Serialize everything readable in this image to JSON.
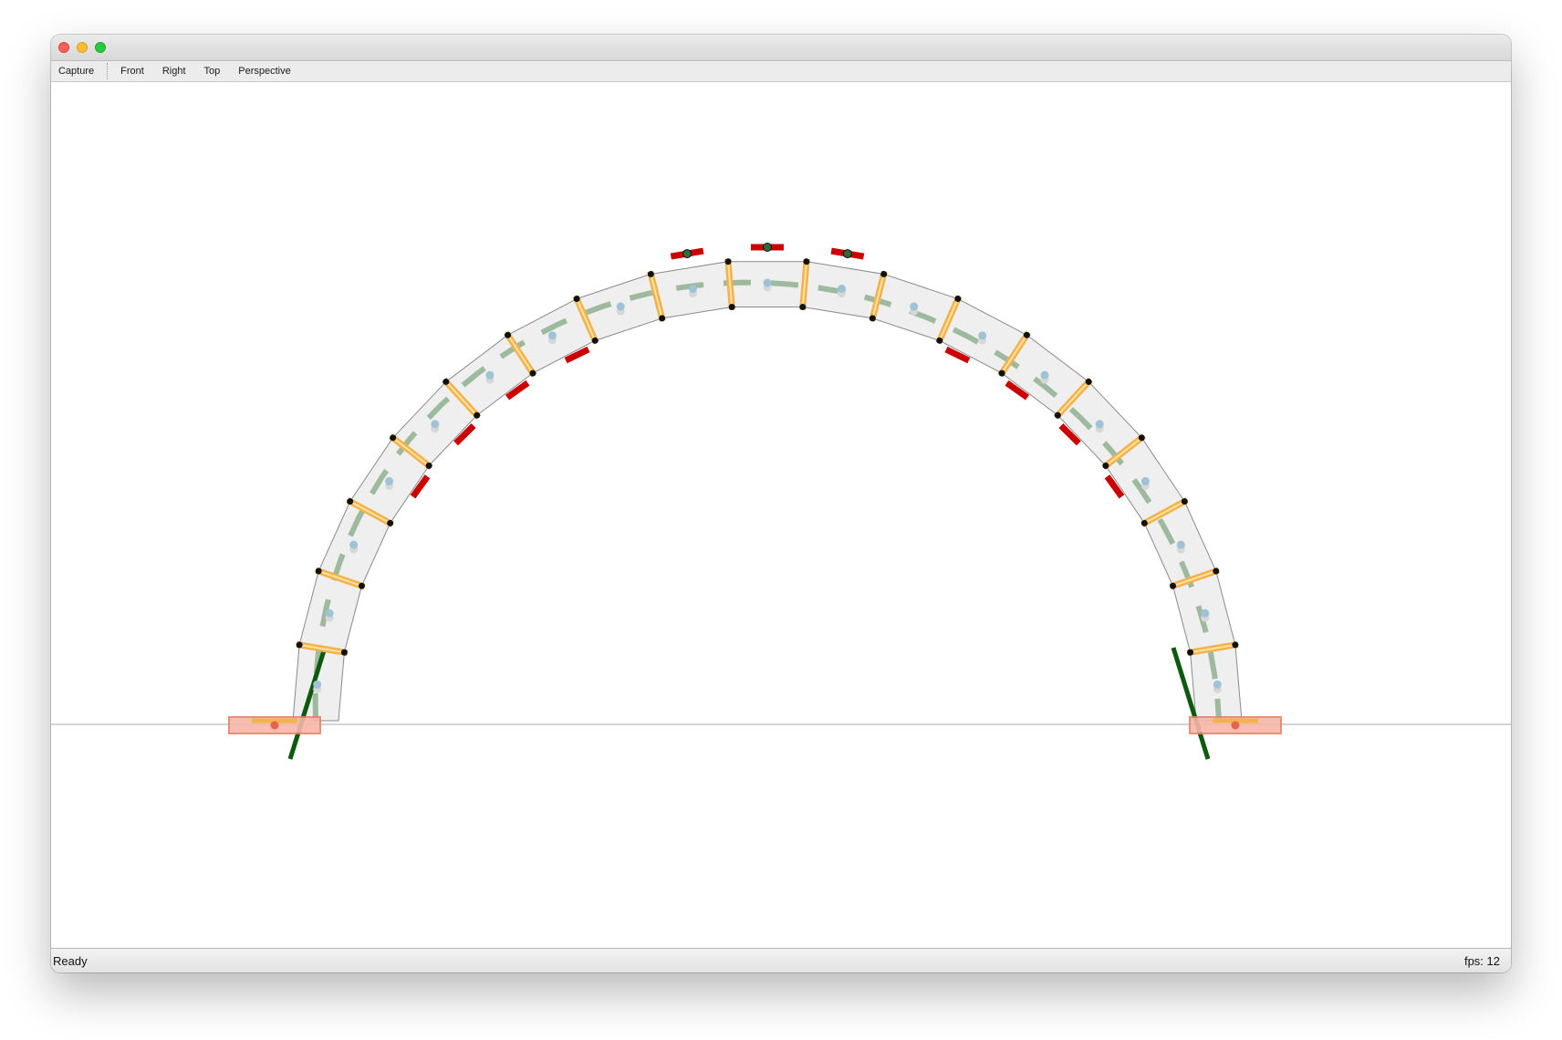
{
  "window": {
    "title": ""
  },
  "toolbar": {
    "capture": "Capture",
    "front": "Front",
    "right": "Right",
    "top": "Top",
    "perspective": "Perspective"
  },
  "status": {
    "message": "Ready",
    "fps": "fps: 12"
  },
  "scene": {
    "segment_count": 19,
    "colors": {
      "segment_fill": "#efefef",
      "segment_stroke": "#8a8a8a",
      "joint_bar": "#f4b24a",
      "joint_bar_inner": "#fbe3a3",
      "node": "#111111",
      "center_marker": "#9ec3d6",
      "support_fill": "#f6b8a8",
      "support_stroke": "#e8816c",
      "support_point": "#e8614a",
      "thrust_line": "#0d5a0d",
      "thrust_line_light": "#8fb08f",
      "force_red": "#cc0000",
      "force_red_light": "#e59a9a",
      "ground_line": "#b9b9b9"
    }
  }
}
